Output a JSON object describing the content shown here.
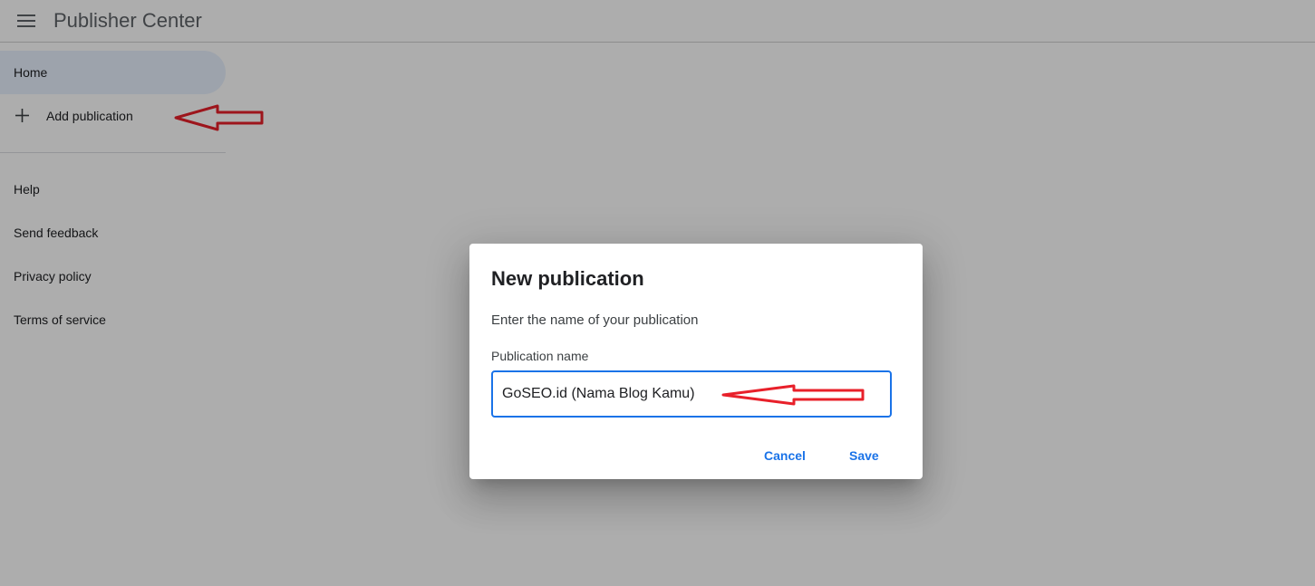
{
  "app": {
    "title": "Publisher Center",
    "menu_icon": "hamburger-menu-icon"
  },
  "sidebar": {
    "items": [
      {
        "label": "Home",
        "active": true
      },
      {
        "label": "Add publication",
        "icon": "plus-icon"
      },
      {
        "label": "Help"
      },
      {
        "label": "Send feedback"
      },
      {
        "label": "Privacy policy"
      },
      {
        "label": "Terms of service"
      }
    ]
  },
  "dialog": {
    "title": "New publication",
    "description": "Enter the name of your publication",
    "field_label": "Publication name",
    "field_value": "GoSEO.id (Nama Blog Kamu)",
    "cancel_label": "Cancel",
    "save_label": "Save"
  },
  "colors": {
    "accent": "#1a73e8",
    "annotation": "#e8202a",
    "scrim": "rgba(0,0,0,0.32)",
    "active_nav": "#e8f0fe"
  },
  "annotations": [
    {
      "icon": "red-arrow-icon",
      "target": "add-publication"
    },
    {
      "icon": "red-arrow-icon",
      "target": "publication-name-field"
    }
  ]
}
